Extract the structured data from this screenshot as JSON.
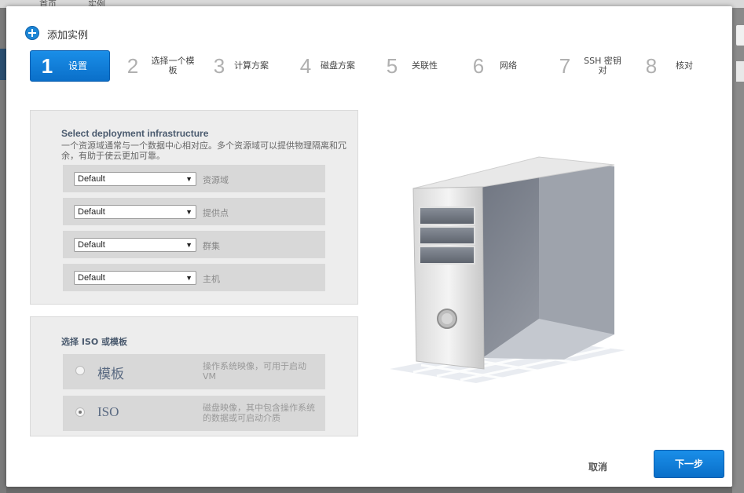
{
  "background": {
    "tab_a": "首页",
    "tab_b": "实例"
  },
  "dialog": {
    "title": "添加实例",
    "steps": [
      {
        "num": "1",
        "label": "设置"
      },
      {
        "num": "2",
        "label": "选择一个模板"
      },
      {
        "num": "3",
        "label": "计算方案"
      },
      {
        "num": "4",
        "label": "磁盘方案"
      },
      {
        "num": "5",
        "label": "关联性"
      },
      {
        "num": "6",
        "label": "网络"
      },
      {
        "num": "7",
        "label": "SSH 密钥对"
      },
      {
        "num": "8",
        "label": "核对"
      }
    ],
    "infra": {
      "title": "Select deployment infrastructure",
      "desc": "一个资源域通常与一个数据中心相对应。多个资源域可以提供物理隔离和冗余，有助于使云更加可靠。",
      "fields": [
        {
          "value": "Default",
          "label": "资源域"
        },
        {
          "value": "Default",
          "label": "提供点"
        },
        {
          "value": "Default",
          "label": "群集"
        },
        {
          "value": "Default",
          "label": "主机"
        }
      ]
    },
    "iso": {
      "title": "选择 ISO 或模板",
      "options": [
        {
          "name": "模板",
          "desc": "操作系统映像，可用于启动 VM",
          "checked": false
        },
        {
          "name": "ISO",
          "desc": "磁盘映像，其中包含操作系统的数据或可启动介质",
          "checked": true
        }
      ]
    },
    "footer": {
      "cancel": "取消",
      "next": "下一步"
    }
  },
  "colors": {
    "accent": "#0a78d8",
    "panel_bg": "#ededed",
    "row_bg": "#d8d8d8"
  }
}
